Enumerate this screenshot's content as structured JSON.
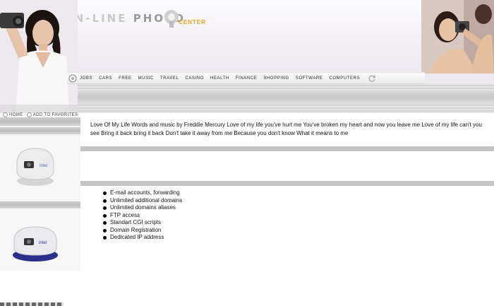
{
  "logo": {
    "prefix": "ON-LINE",
    "main": "PHOTO",
    "suffix": "CENTER"
  },
  "colors": {
    "accent": "#e8a11d",
    "band": "#c4c4c4",
    "nav_bg": "#f2f2f2"
  },
  "nav": {
    "icon": "camera-shutter-icon",
    "end_icon": "refresh-icon",
    "items": [
      "JOBS",
      "CARS",
      "FREE",
      "MUSIC",
      "TRAVEL",
      "CASINO",
      "HEALTH",
      "FINANCE",
      "SHOPPING",
      "SOFTWARE",
      "COMPUTERS"
    ]
  },
  "crumbs": {
    "home": "HOME",
    "favorites": "ADD TO FAVORITES"
  },
  "main": {
    "paragraph": "Love Of My Life Words and music by Freddie Mercury Love of my life you've hurt me You've broken my heart and now you leave me Love of my life can't you see Bring it back bring it back Don't take it away from me Because you don't know What it means to me",
    "features": [
      "E-mail accounts, forwarding",
      "Unlimited additional domains",
      "Unlimited domains aliases",
      "FTP access",
      "Standart CGI scripts",
      "Domain Registration",
      "Dedicated IP address"
    ]
  },
  "products": [
    {
      "name": "webcam-white",
      "brand": "intel"
    },
    {
      "name": "webcam-blue",
      "brand": "intel"
    }
  ]
}
